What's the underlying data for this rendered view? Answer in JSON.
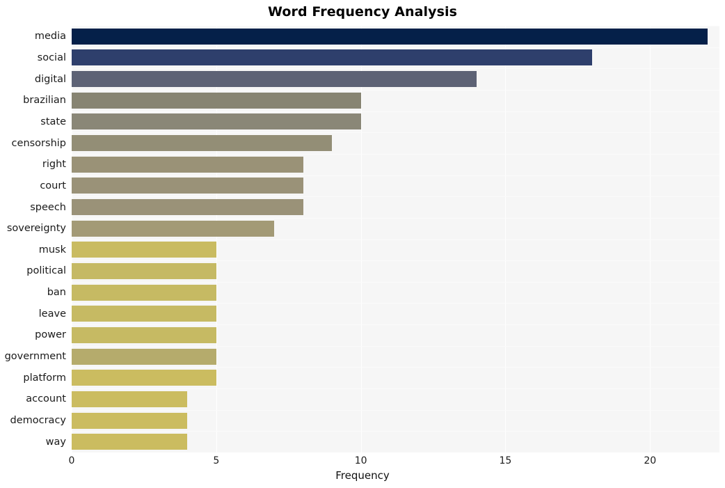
{
  "chart_data": {
    "type": "bar",
    "orientation": "horizontal",
    "title": "Word Frequency Analysis",
    "xlabel": "Frequency",
    "ylabel": "",
    "xlim": [
      0,
      22.4
    ],
    "ylim": [
      0,
      20
    ],
    "grid": true,
    "legend": null,
    "xticks": [
      "0",
      "5",
      "10",
      "15",
      "20"
    ],
    "xtick_values": [
      0,
      5,
      10,
      15,
      20
    ],
    "categories": [
      "media",
      "social",
      "digital",
      "brazilian",
      "state",
      "censorship",
      "right",
      "court",
      "speech",
      "sovereignty",
      "musk",
      "political",
      "ban",
      "leave",
      "power",
      "government",
      "platform",
      "account",
      "democracy",
      "way"
    ],
    "values": [
      22,
      18,
      14,
      10,
      10,
      9,
      8,
      8,
      8,
      7,
      5,
      5,
      5,
      5,
      5,
      5,
      5,
      4,
      4,
      4
    ],
    "bar_colors": [
      "#052049",
      "#2e3f6c",
      "#5d6275",
      "#878472",
      "#8a8777",
      "#938e76",
      "#9a9277",
      "#9a9278",
      "#9a9278",
      "#a39a76",
      "#c9bb61",
      "#c5b964",
      "#c6ba63",
      "#c6ba63",
      "#c6ba63",
      "#b5ab6c",
      "#cbbc60",
      "#cbbc60",
      "#cbbc60",
      "#cbbc60"
    ],
    "colors": {
      "figure_background": "#ffffff",
      "plot_background": "#f6f6f6",
      "gridline": "#ffffff",
      "title_text": "#000000",
      "tick_text": "#1a1a1a"
    }
  },
  "chart": {
    "title": "Word Frequency Analysis",
    "x_axis_title": "Frequency"
  }
}
